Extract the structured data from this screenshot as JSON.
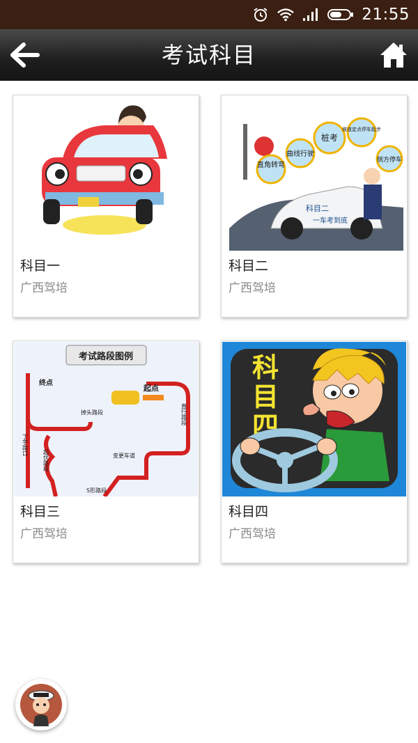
{
  "status_bar": {
    "time": "21:55",
    "background": "#3a1f12"
  },
  "header": {
    "title": "考试科目",
    "back_icon": "back-arrow-icon",
    "home_icon": "home-icon"
  },
  "cards": [
    {
      "title": "科目一",
      "subtitle": "广西驾培",
      "image": "cartoon-driver-car"
    },
    {
      "title": "科目二",
      "subtitle": "广西驾培",
      "image": "car-police-signs",
      "image_labels": [
        "桩考",
        "坡道定点停车起步",
        "直角转弯",
        "曲线行驶",
        "侧方停车",
        "科目二",
        "一车考到底"
      ]
    },
    {
      "title": "科目三",
      "subtitle": "广西驾培",
      "image": "route-map",
      "image_labels": [
        "考试路段图例",
        "终点",
        "起点",
        "掉头路段",
        "直行路段",
        "丁字路口",
        "起伏路段",
        "变更车道",
        "S形路段"
      ]
    },
    {
      "title": "科目四",
      "subtitle": "广西驾培",
      "image": "angry-driver",
      "image_labels": [
        "科",
        "目",
        "四"
      ]
    }
  ]
}
